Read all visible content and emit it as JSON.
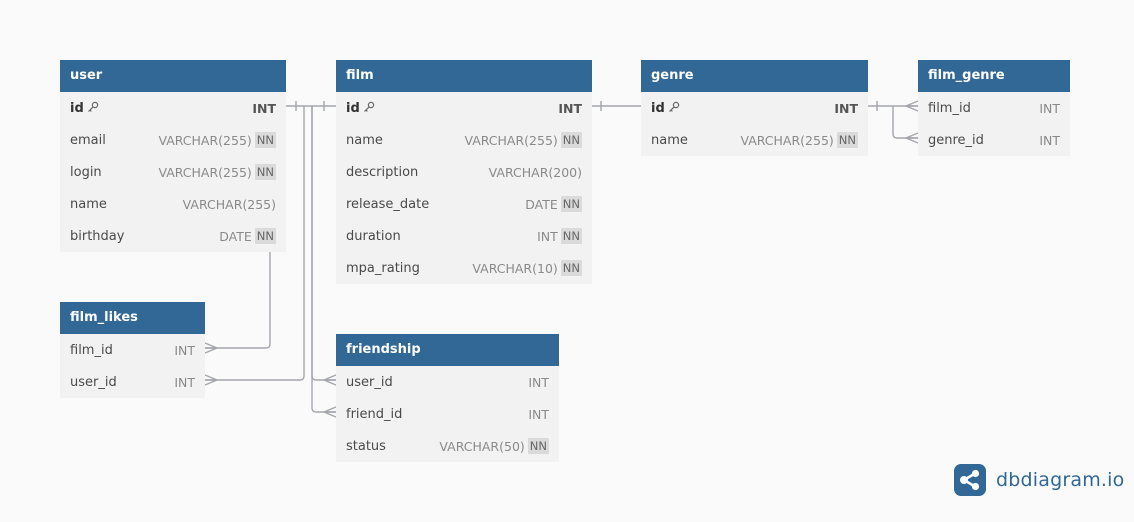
{
  "tables": {
    "user": {
      "name": "user",
      "fields": [
        {
          "name": "id",
          "type": "INT",
          "pk": true,
          "nn": false
        },
        {
          "name": "email",
          "type": "VARCHAR(255)",
          "pk": false,
          "nn": true
        },
        {
          "name": "login",
          "type": "VARCHAR(255)",
          "pk": false,
          "nn": true
        },
        {
          "name": "name",
          "type": "VARCHAR(255)",
          "pk": false,
          "nn": false
        },
        {
          "name": "birthday",
          "type": "DATE",
          "pk": false,
          "nn": true
        }
      ]
    },
    "film": {
      "name": "film",
      "fields": [
        {
          "name": "id",
          "type": "INT",
          "pk": true,
          "nn": false
        },
        {
          "name": "name",
          "type": "VARCHAR(255)",
          "pk": false,
          "nn": true
        },
        {
          "name": "description",
          "type": "VARCHAR(200)",
          "pk": false,
          "nn": false
        },
        {
          "name": "release_date",
          "type": "DATE",
          "pk": false,
          "nn": true
        },
        {
          "name": "duration",
          "type": "INT",
          "pk": false,
          "nn": true
        },
        {
          "name": "mpa_rating",
          "type": "VARCHAR(10)",
          "pk": false,
          "nn": true
        }
      ]
    },
    "genre": {
      "name": "genre",
      "fields": [
        {
          "name": "id",
          "type": "INT",
          "pk": true,
          "nn": false
        },
        {
          "name": "name",
          "type": "VARCHAR(255)",
          "pk": false,
          "nn": true
        }
      ]
    },
    "film_genre": {
      "name": "film_genre",
      "fields": [
        {
          "name": "film_id",
          "type": "INT",
          "pk": false,
          "nn": false
        },
        {
          "name": "genre_id",
          "type": "INT",
          "pk": false,
          "nn": false
        }
      ]
    },
    "film_likes": {
      "name": "film_likes",
      "fields": [
        {
          "name": "film_id",
          "type": "INT",
          "pk": false,
          "nn": false
        },
        {
          "name": "user_id",
          "type": "INT",
          "pk": false,
          "nn": false
        }
      ]
    },
    "friendship": {
      "name": "friendship",
      "fields": [
        {
          "name": "user_id",
          "type": "INT",
          "pk": false,
          "nn": false
        },
        {
          "name": "friend_id",
          "type": "INT",
          "pk": false,
          "nn": false
        },
        {
          "name": "status",
          "type": "VARCHAR(50)",
          "pk": false,
          "nn": true
        }
      ]
    }
  },
  "nn_label": "NN",
  "relationships": [
    {
      "from": "user.id",
      "to": "film_likes.user_id",
      "type": "one-to-many"
    },
    {
      "from": "film.id",
      "to": "film_likes.film_id",
      "type": "one-to-many"
    },
    {
      "from": "user.id",
      "to": "friendship.user_id",
      "type": "one-to-many"
    },
    {
      "from": "user.id",
      "to": "friendship.friend_id",
      "type": "one-to-many"
    },
    {
      "from": "genre.id",
      "to": "film_genre.genre_id",
      "type": "one-to-many"
    },
    {
      "from": "film.id",
      "to": "film_genre.film_id",
      "type": "one-to-many"
    }
  ],
  "brand": {
    "name": "dbdiagram.io",
    "color": "#316896"
  },
  "colors": {
    "header": "#316896",
    "body": "#f2f2f2",
    "edge": "#a5a5ae",
    "nn_badge": "#dadada"
  },
  "icons": {
    "primary_key": "key-icon",
    "brand": "share-nodes-icon"
  }
}
